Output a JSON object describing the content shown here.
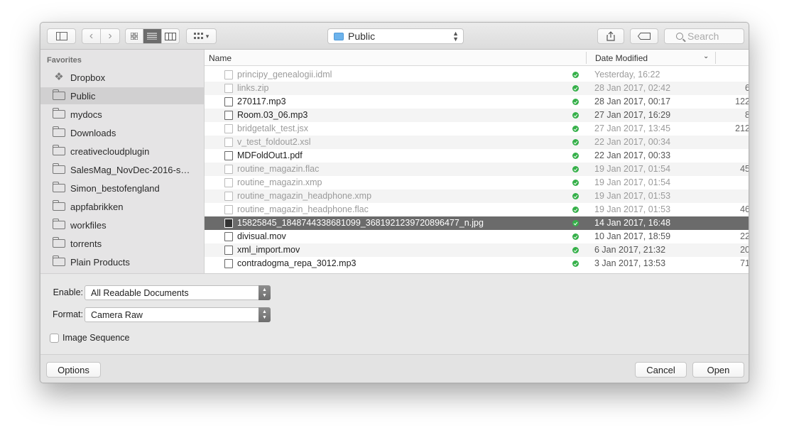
{
  "toolbar": {
    "location": "Public",
    "search_placeholder": "Search"
  },
  "sidebar": {
    "heading": "Favorites",
    "items": [
      {
        "label": "Dropbox",
        "icon": "dropbox-icon"
      },
      {
        "label": "Public",
        "icon": "folder-icon",
        "selected": true
      },
      {
        "label": "mydocs",
        "icon": "folder-icon"
      },
      {
        "label": "Downloads",
        "icon": "folder-icon"
      },
      {
        "label": "creativecloudplugin",
        "icon": "folder-icon"
      },
      {
        "label": "SalesMag_NovDec-2016-s…",
        "icon": "folder-icon"
      },
      {
        "label": "Simon_bestofengland",
        "icon": "folder-icon"
      },
      {
        "label": "appfabrikken",
        "icon": "folder-icon"
      },
      {
        "label": "workfiles",
        "icon": "folder-icon"
      },
      {
        "label": "torrents",
        "icon": "folder-icon"
      },
      {
        "label": "Plain Products",
        "icon": "folder-icon"
      }
    ]
  },
  "filelist": {
    "columns": {
      "name": "Name",
      "date": "Date Modified"
    },
    "files": [
      {
        "name": "principy_genealogii.idml",
        "date": "Yesterday, 16:22",
        "size": "",
        "dim": true
      },
      {
        "name": "links.zip",
        "date": "28 Jan 2017, 02:42",
        "size": "6",
        "dim": true
      },
      {
        "name": "270117.mp3",
        "date": "28 Jan 2017, 00:17",
        "size": "122",
        "dim": false
      },
      {
        "name": "Room.03_06.mp3",
        "date": "27 Jan 2017, 16:29",
        "size": "8",
        "dim": false
      },
      {
        "name": "bridgetalk_test.jsx",
        "date": "27 Jan 2017, 13:45",
        "size": "212",
        "dim": true
      },
      {
        "name": "v_test_foldout2.xsl",
        "date": "22 Jan 2017, 00:34",
        "size": "",
        "dim": true
      },
      {
        "name": "MDFoldOut1.pdf",
        "date": "22 Jan 2017, 00:33",
        "size": "",
        "dim": false
      },
      {
        "name": "routine_magazin.flac",
        "date": "19 Jan 2017, 01:54",
        "size": "45",
        "dim": true
      },
      {
        "name": "routine_magazin.xmp",
        "date": "19 Jan 2017, 01:54",
        "size": "",
        "dim": true
      },
      {
        "name": "routine_magazin_headphone.xmp",
        "date": "19 Jan 2017, 01:53",
        "size": "",
        "dim": true
      },
      {
        "name": "routine_magazin_headphone.flac",
        "date": "19 Jan 2017, 01:53",
        "size": "46",
        "dim": true
      },
      {
        "name": "15825845_1848744338681099_3681921239720896477_n.jpg",
        "date": "14 Jan 2017, 16:48",
        "size": "",
        "dim": false,
        "selected": true
      },
      {
        "name": "divisual.mov",
        "date": "10 Jan 2017, 18:59",
        "size": "22",
        "dim": false
      },
      {
        "name": "xml_import.mov",
        "date": "6 Jan 2017, 21:32",
        "size": "20",
        "dim": false
      },
      {
        "name": "contradogma_repa_3012.mp3",
        "date": "3 Jan 2017, 13:53",
        "size": "71",
        "dim": false
      }
    ]
  },
  "options": {
    "enable_label": "Enable:",
    "enable_value": "All Readable Documents",
    "format_label": "Format:",
    "format_value": "Camera Raw",
    "image_sequence_label": "Image Sequence"
  },
  "buttons": {
    "options": "Options",
    "cancel": "Cancel",
    "open": "Open"
  },
  "colors": {
    "selection": "#6b6b6b",
    "sync_check": "#35b049",
    "folder_blue": "#6db3ec"
  }
}
